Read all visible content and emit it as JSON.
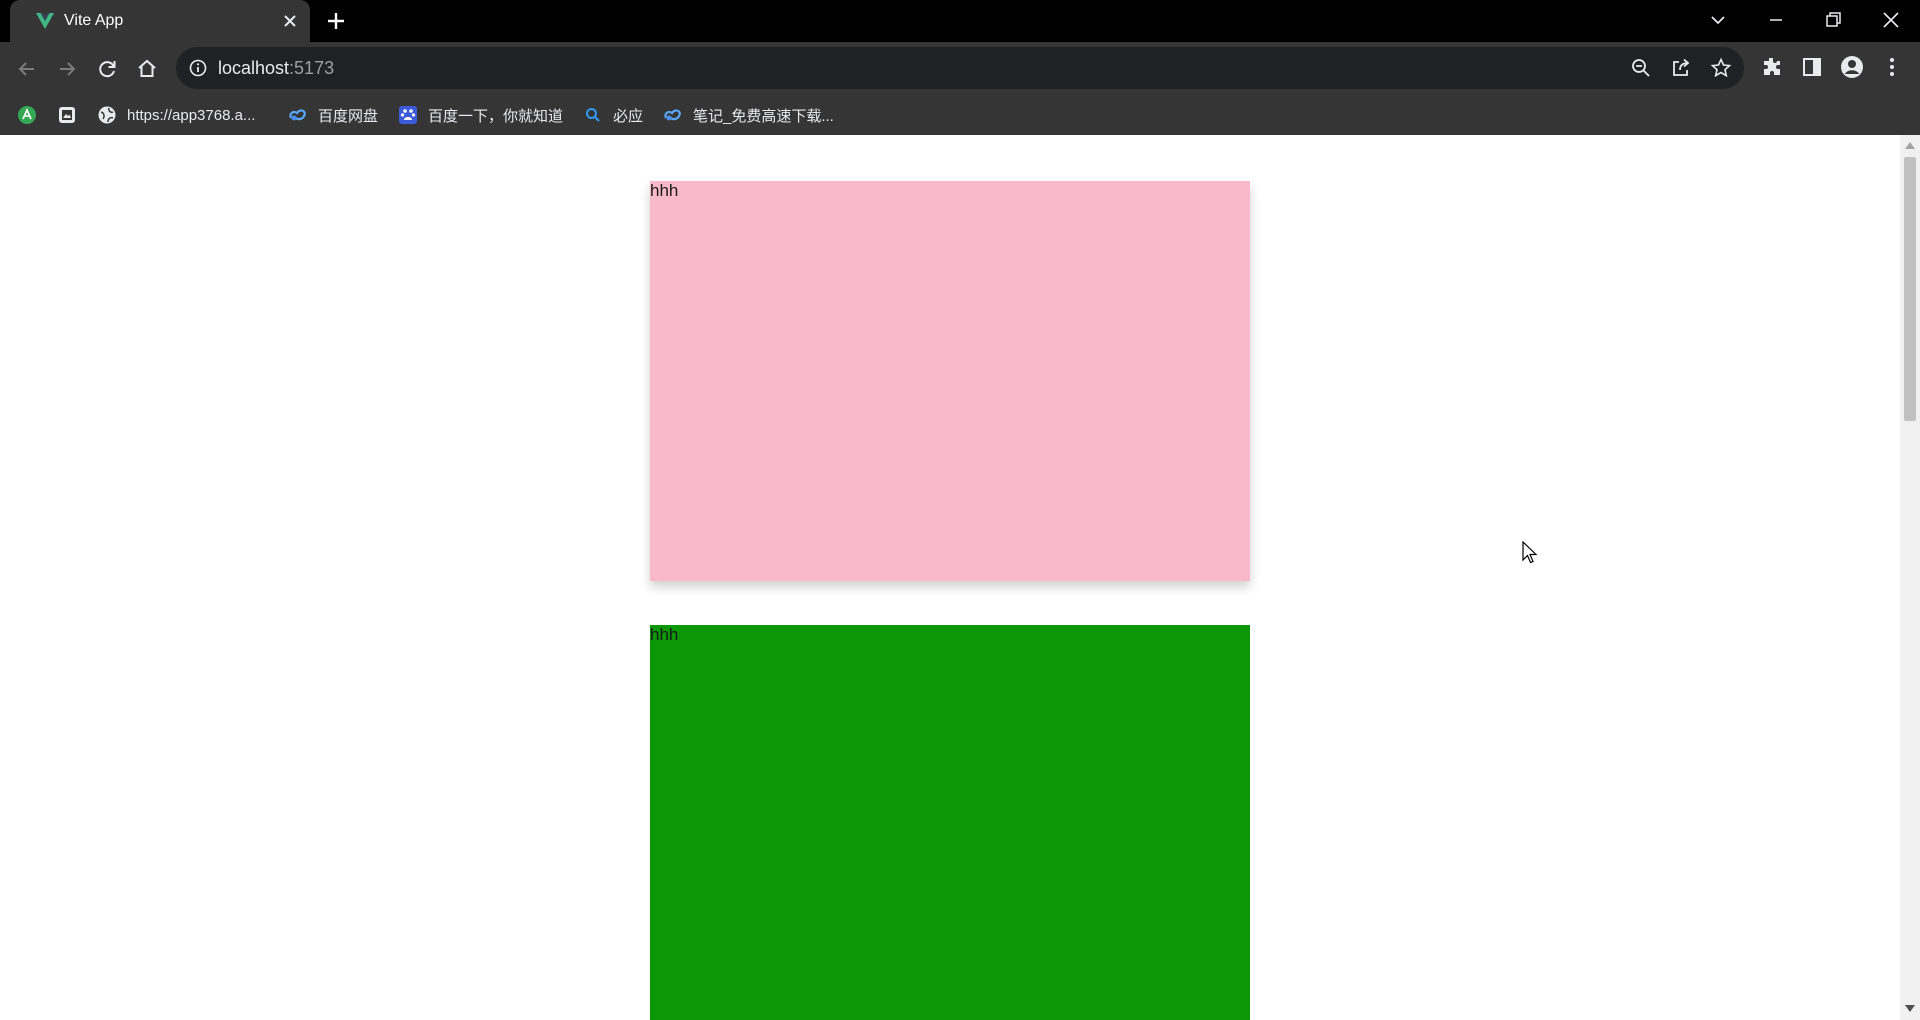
{
  "browser": {
    "tab": {
      "title": "Vite App",
      "favicon": "vite-logo-icon"
    },
    "address": {
      "host": "localhost",
      "port": ":5173"
    },
    "bookmarks": [
      {
        "label": "",
        "icon": "app-icon"
      },
      {
        "label": "",
        "icon": "image-app-icon"
      },
      {
        "label": "https://app3768.a...",
        "icon": "globe-icon"
      },
      {
        "label": "百度网盘",
        "icon": "baidu-netdisk-icon"
      },
      {
        "label": "百度一下，你就知道",
        "icon": "baidu-paw-icon"
      },
      {
        "label": "必应",
        "icon": "bing-search-icon"
      },
      {
        "label": "笔记_免费高速下载...",
        "icon": "baidu-netdisk-icon"
      }
    ]
  },
  "page": {
    "boxes": [
      {
        "text": "hhh",
        "color": "#f9b8cc"
      },
      {
        "text": "hhh",
        "color": "#0c9706"
      }
    ]
  },
  "colors": {
    "tabstrip": "#000000",
    "toolbar": "#353535",
    "omnibox": "#202124",
    "scrollbar_thumb": "#c1c1c1"
  }
}
